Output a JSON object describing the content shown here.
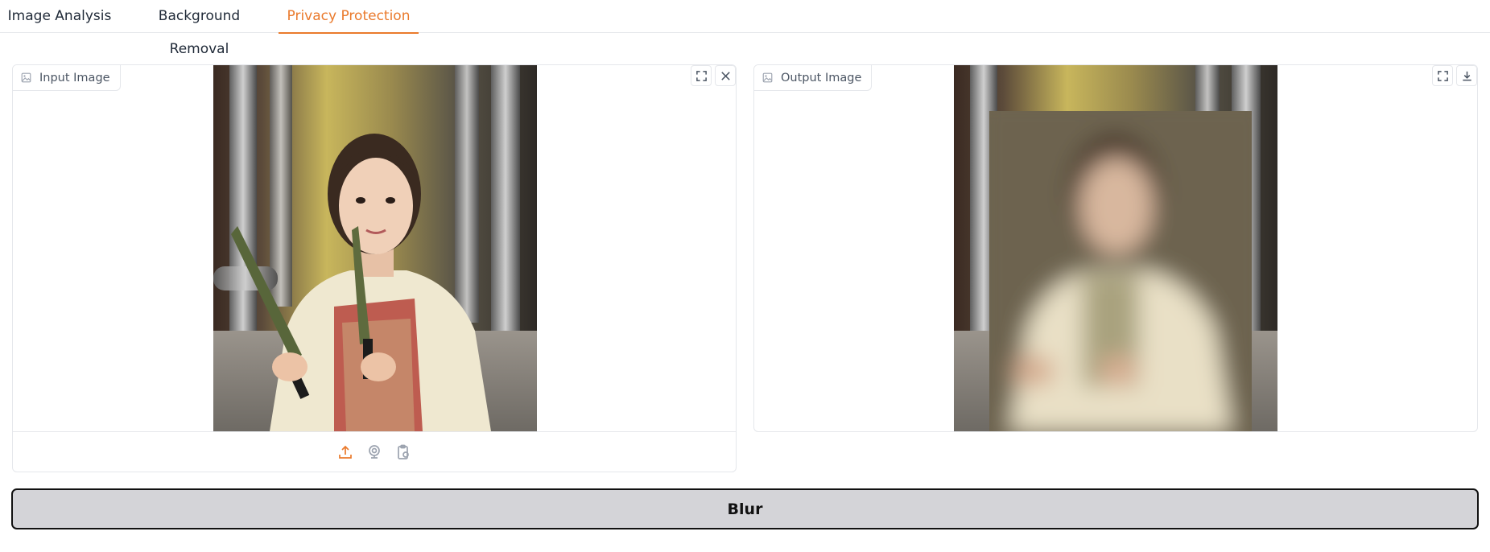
{
  "tabs": [
    {
      "label": "Image Analysis",
      "active": false
    },
    {
      "label": "Background Removal",
      "active": false
    },
    {
      "label": "Privacy Protection",
      "active": true
    }
  ],
  "input_panel": {
    "label": "Input Image",
    "tools": [
      "fullscreen-icon",
      "close-icon"
    ],
    "sources": [
      "upload-icon",
      "webcam-icon",
      "clipboard-icon"
    ]
  },
  "output_panel": {
    "label": "Output Image",
    "tools": [
      "fullscreen-icon",
      "download-icon"
    ]
  },
  "action": {
    "label": "Blur"
  },
  "colors": {
    "accent": "#ea7a2c",
    "border": "#e5e7eb",
    "button_bg": "#d4d4d8"
  }
}
